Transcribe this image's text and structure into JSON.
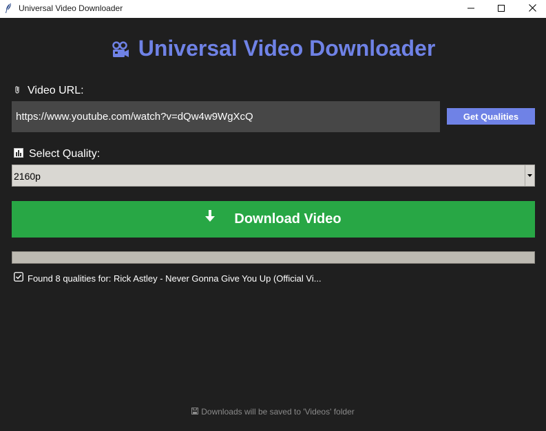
{
  "window": {
    "title": "Universal Video Downloader",
    "app_icon": "feather-icon"
  },
  "header": {
    "title": "Universal Video Downloader",
    "icon": "video-camera-icon",
    "accent_color": "#6f82e6"
  },
  "url_section": {
    "label": "Video URL:",
    "icon": "paperclip-icon",
    "value": "https://www.youtube.com/watch?v=dQw4w9WgXcQ",
    "button_label": "Get Qualities"
  },
  "quality_section": {
    "label": "Select Quality:",
    "icon": "bar-chart-icon",
    "selected": "2160p"
  },
  "download": {
    "label": "Download Video",
    "icon": "down-arrow-icon",
    "color": "#28a745"
  },
  "progress": {
    "value": 0
  },
  "status": {
    "icon": "checkbox-check-icon",
    "text": "Found 8 qualities for: Rick Astley - Never Gonna Give You Up (Official Vi..."
  },
  "footer": {
    "icon": "floppy-disk-icon",
    "text": "Downloads will be saved to 'Videos' folder"
  }
}
